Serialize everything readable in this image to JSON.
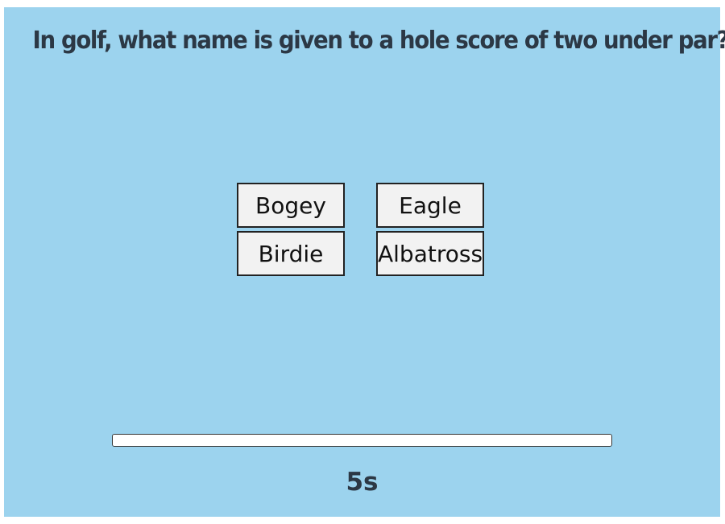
{
  "quiz": {
    "question": "In golf, what name is given to a hole score of two under par?",
    "answers": [
      "Bogey",
      "Eagle",
      "Birdie",
      "Albatross"
    ],
    "timer": {
      "label": "5s",
      "progress": 1.0
    }
  },
  "colors": {
    "background": "#9cd3ee",
    "text": "#2c3845",
    "button_bg": "#f2f2f2",
    "button_border": "#222222"
  }
}
